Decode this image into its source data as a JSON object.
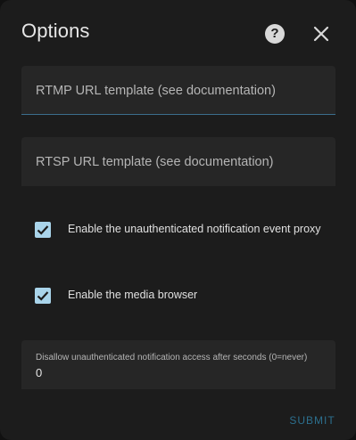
{
  "dialog": {
    "title": "Options",
    "help_icon": "help-circle-icon",
    "close_icon": "close-icon"
  },
  "fields": {
    "rtmp": {
      "placeholder": "RTMP URL template (see documentation)",
      "value": ""
    },
    "rtsp": {
      "placeholder": "RTSP URL template (see documentation)",
      "value": ""
    }
  },
  "checkboxes": {
    "proxy": {
      "label": "Enable the unauthenticated notification event proxy",
      "checked": true
    },
    "media": {
      "label": "Enable the media browser",
      "checked": true
    }
  },
  "timeout_field": {
    "label": "Disallow unauthenticated notification access after seconds (0=never)",
    "value": "0"
  },
  "actions": {
    "submit_label": "SUBMIT"
  },
  "colors": {
    "dialog_bg": "#1c1c1c",
    "field_bg": "#262626",
    "accent": "#a9d4ea",
    "submit_text": "#2c6f8e"
  }
}
